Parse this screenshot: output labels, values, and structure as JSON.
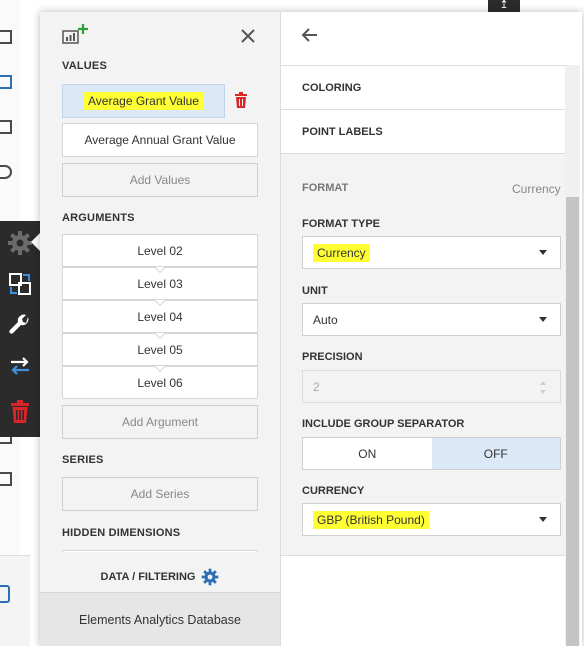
{
  "left_panel": {
    "sections": {
      "values": "VALUES",
      "arguments": "ARGUMENTS",
      "series": "SERIES",
      "hidden_dimensions": "HIDDEN DIMENSIONS"
    },
    "values": [
      "Average Grant Value",
      "Average Annual Grant Value"
    ],
    "add_values": "Add Values",
    "arguments": [
      "Level 02",
      "Level 03",
      "Level 04",
      "Level 05",
      "Level 06"
    ],
    "add_argument": "Add Argument",
    "add_series": "Add Series",
    "data_filtering": "DATA / FILTERING",
    "footer": "Elements Analytics Database"
  },
  "right_panel": {
    "coloring": "COLORING",
    "point_labels": "POINT LABELS",
    "format": {
      "label": "FORMAT",
      "value": "Currency"
    },
    "format_type": {
      "label": "FORMAT TYPE",
      "value": "Currency"
    },
    "unit": {
      "label": "UNIT",
      "value": "Auto"
    },
    "precision": {
      "label": "PRECISION",
      "value": "2"
    },
    "group_separator": {
      "label": "INCLUDE GROUP SEPARATOR",
      "on": "ON",
      "off": "OFF",
      "selected": "OFF"
    },
    "currency": {
      "label": "CURRENCY",
      "value": "GBP (British Pound)"
    }
  },
  "colors": {
    "accent_blue": "#2d6fb5",
    "selected_bg": "#dbe8f7",
    "highlight": "#ffff33",
    "delete_red": "#d9262b",
    "toolbar_dark": "#2b2b2b"
  }
}
